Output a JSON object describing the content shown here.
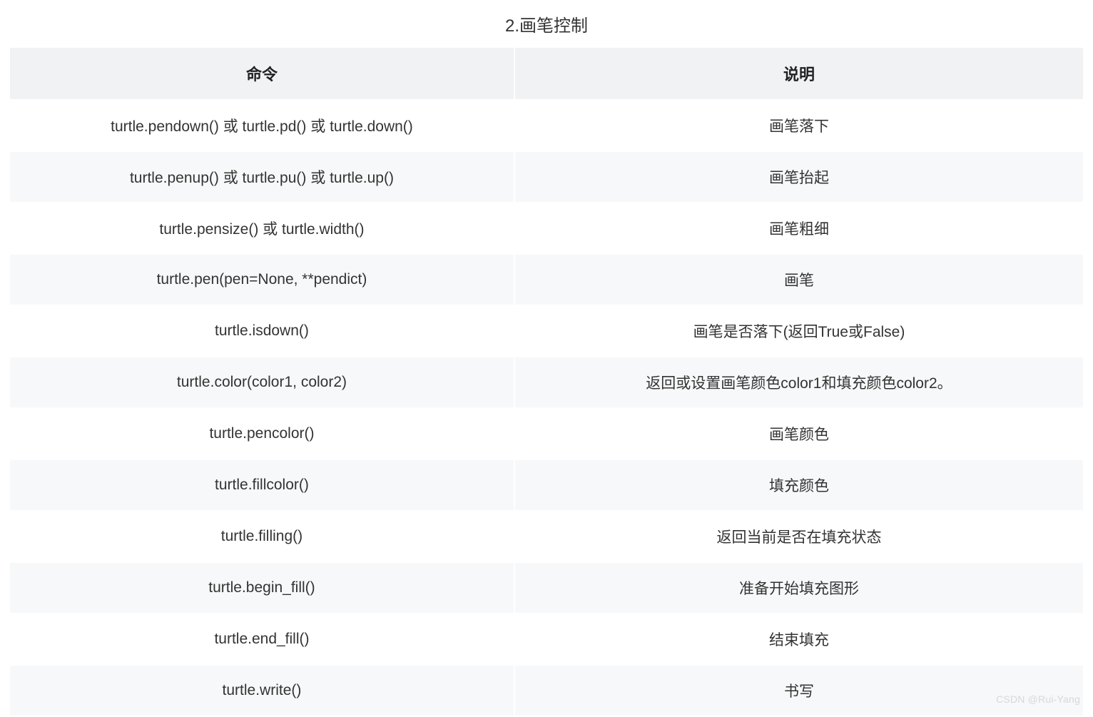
{
  "caption": "2.画笔控制",
  "headers": {
    "command": "命令",
    "description": "说明"
  },
  "rows": [
    {
      "command": "turtle.pendown() 或 turtle.pd() 或 turtle.down()",
      "description": "画笔落下"
    },
    {
      "command": "turtle.penup() 或 turtle.pu() 或 turtle.up()",
      "description": "画笔抬起"
    },
    {
      "command": "turtle.pensize() 或 turtle.width()",
      "description": "画笔粗细"
    },
    {
      "command": "turtle.pen(pen=None, **pendict)",
      "description": "画笔"
    },
    {
      "command": "turtle.isdown()",
      "description": "画笔是否落下(返回True或False)"
    },
    {
      "command": "turtle.color(color1, color2)",
      "description": "返回或设置画笔颜色color1和填充颜色color2。"
    },
    {
      "command": "turtle.pencolor()",
      "description": "画笔颜色"
    },
    {
      "command": "turtle.fillcolor()",
      "description": "填充颜色"
    },
    {
      "command": "turtle.filling()",
      "description": "返回当前是否在填充状态"
    },
    {
      "command": "turtle.begin_fill()",
      "description": "准备开始填充图形"
    },
    {
      "command": "turtle.end_fill()",
      "description": "结束填充"
    },
    {
      "command": "turtle.write()",
      "description": "书写"
    }
  ],
  "watermark": "CSDN @Rui-Yang"
}
